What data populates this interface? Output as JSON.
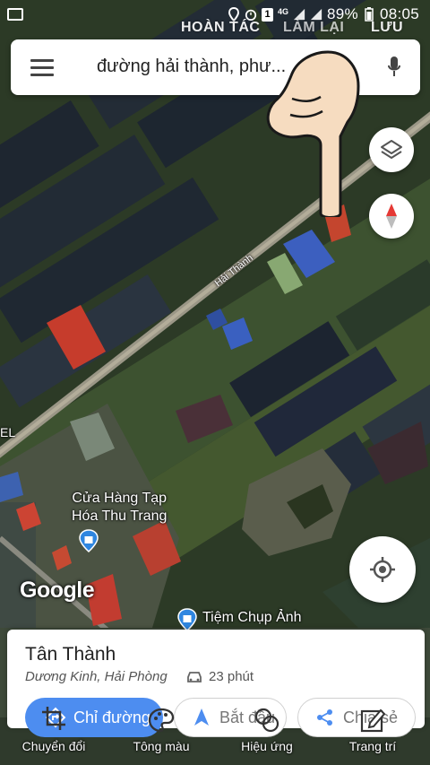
{
  "status_bar": {
    "network": "4G",
    "notification_count": "1",
    "battery": "89%",
    "time": "08:05"
  },
  "editor_top": {
    "undo": "HOÀN TÁC",
    "redo": "LÀM LẠI",
    "save": "LƯU"
  },
  "search": {
    "query": "đường hải thành, phư..."
  },
  "map": {
    "road_label": "Hải Thành",
    "left_edge_label": "EL",
    "poi_1": [
      "Cửa Hàng Tạp",
      "Hóa Thu Trang"
    ],
    "poi_2": "Tiệm Chụp Ảnh",
    "logo": "Google"
  },
  "place_card": {
    "title": "Tân Thành",
    "subtitle": "Dương Kinh, Hải Phòng",
    "drive_time": "23 phút",
    "directions_label": "Chỉ đường",
    "start_label": "Bắt đầu",
    "share_label": "Chia sẻ"
  },
  "editor_bar": {
    "items": [
      "Chuyển đổi",
      "Tông màu",
      "Hiệu ứng",
      "Trang trí"
    ]
  },
  "colors": {
    "accent_blue": "#4d8df0",
    "compass_red": "#e53935"
  }
}
